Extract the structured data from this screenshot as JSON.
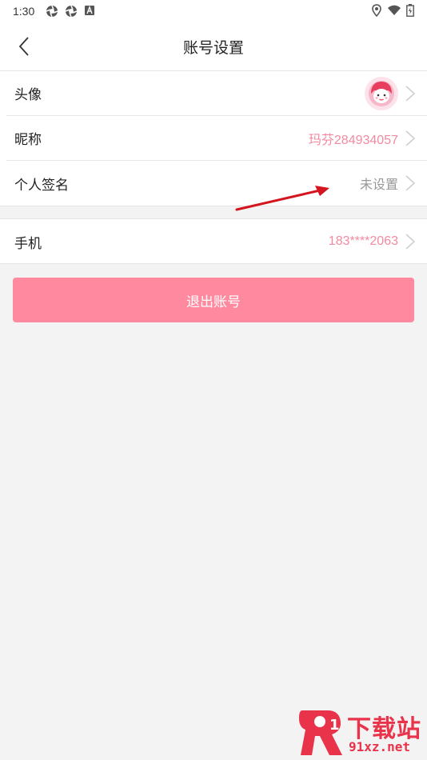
{
  "status_bar": {
    "time": "1:30",
    "icons_left": [
      "aperture-icon",
      "aperture-icon",
      "font-a-icon"
    ],
    "icons_right": [
      "location-icon",
      "wifi-icon",
      "battery-icon"
    ]
  },
  "header": {
    "title": "账号设置",
    "back_icon": "chevron-left-icon"
  },
  "profile_group": {
    "avatar_row": {
      "label": "头像"
    },
    "nickname_row": {
      "label": "昵称",
      "value": "玛芬284934057"
    },
    "signature_row": {
      "label": "个人签名",
      "value": "未设置"
    }
  },
  "contact_group": {
    "phone_row": {
      "label": "手机",
      "value": "183****2063"
    }
  },
  "logout_button": {
    "label": "退出账号"
  },
  "watermark": {
    "title": "下载站",
    "url": "91xz.net"
  },
  "colors": {
    "accent_pink": "#f48aa0",
    "button_pink": "#ff8aa0",
    "background": "#f3f3f3",
    "annotation_red": "#d4141e"
  }
}
